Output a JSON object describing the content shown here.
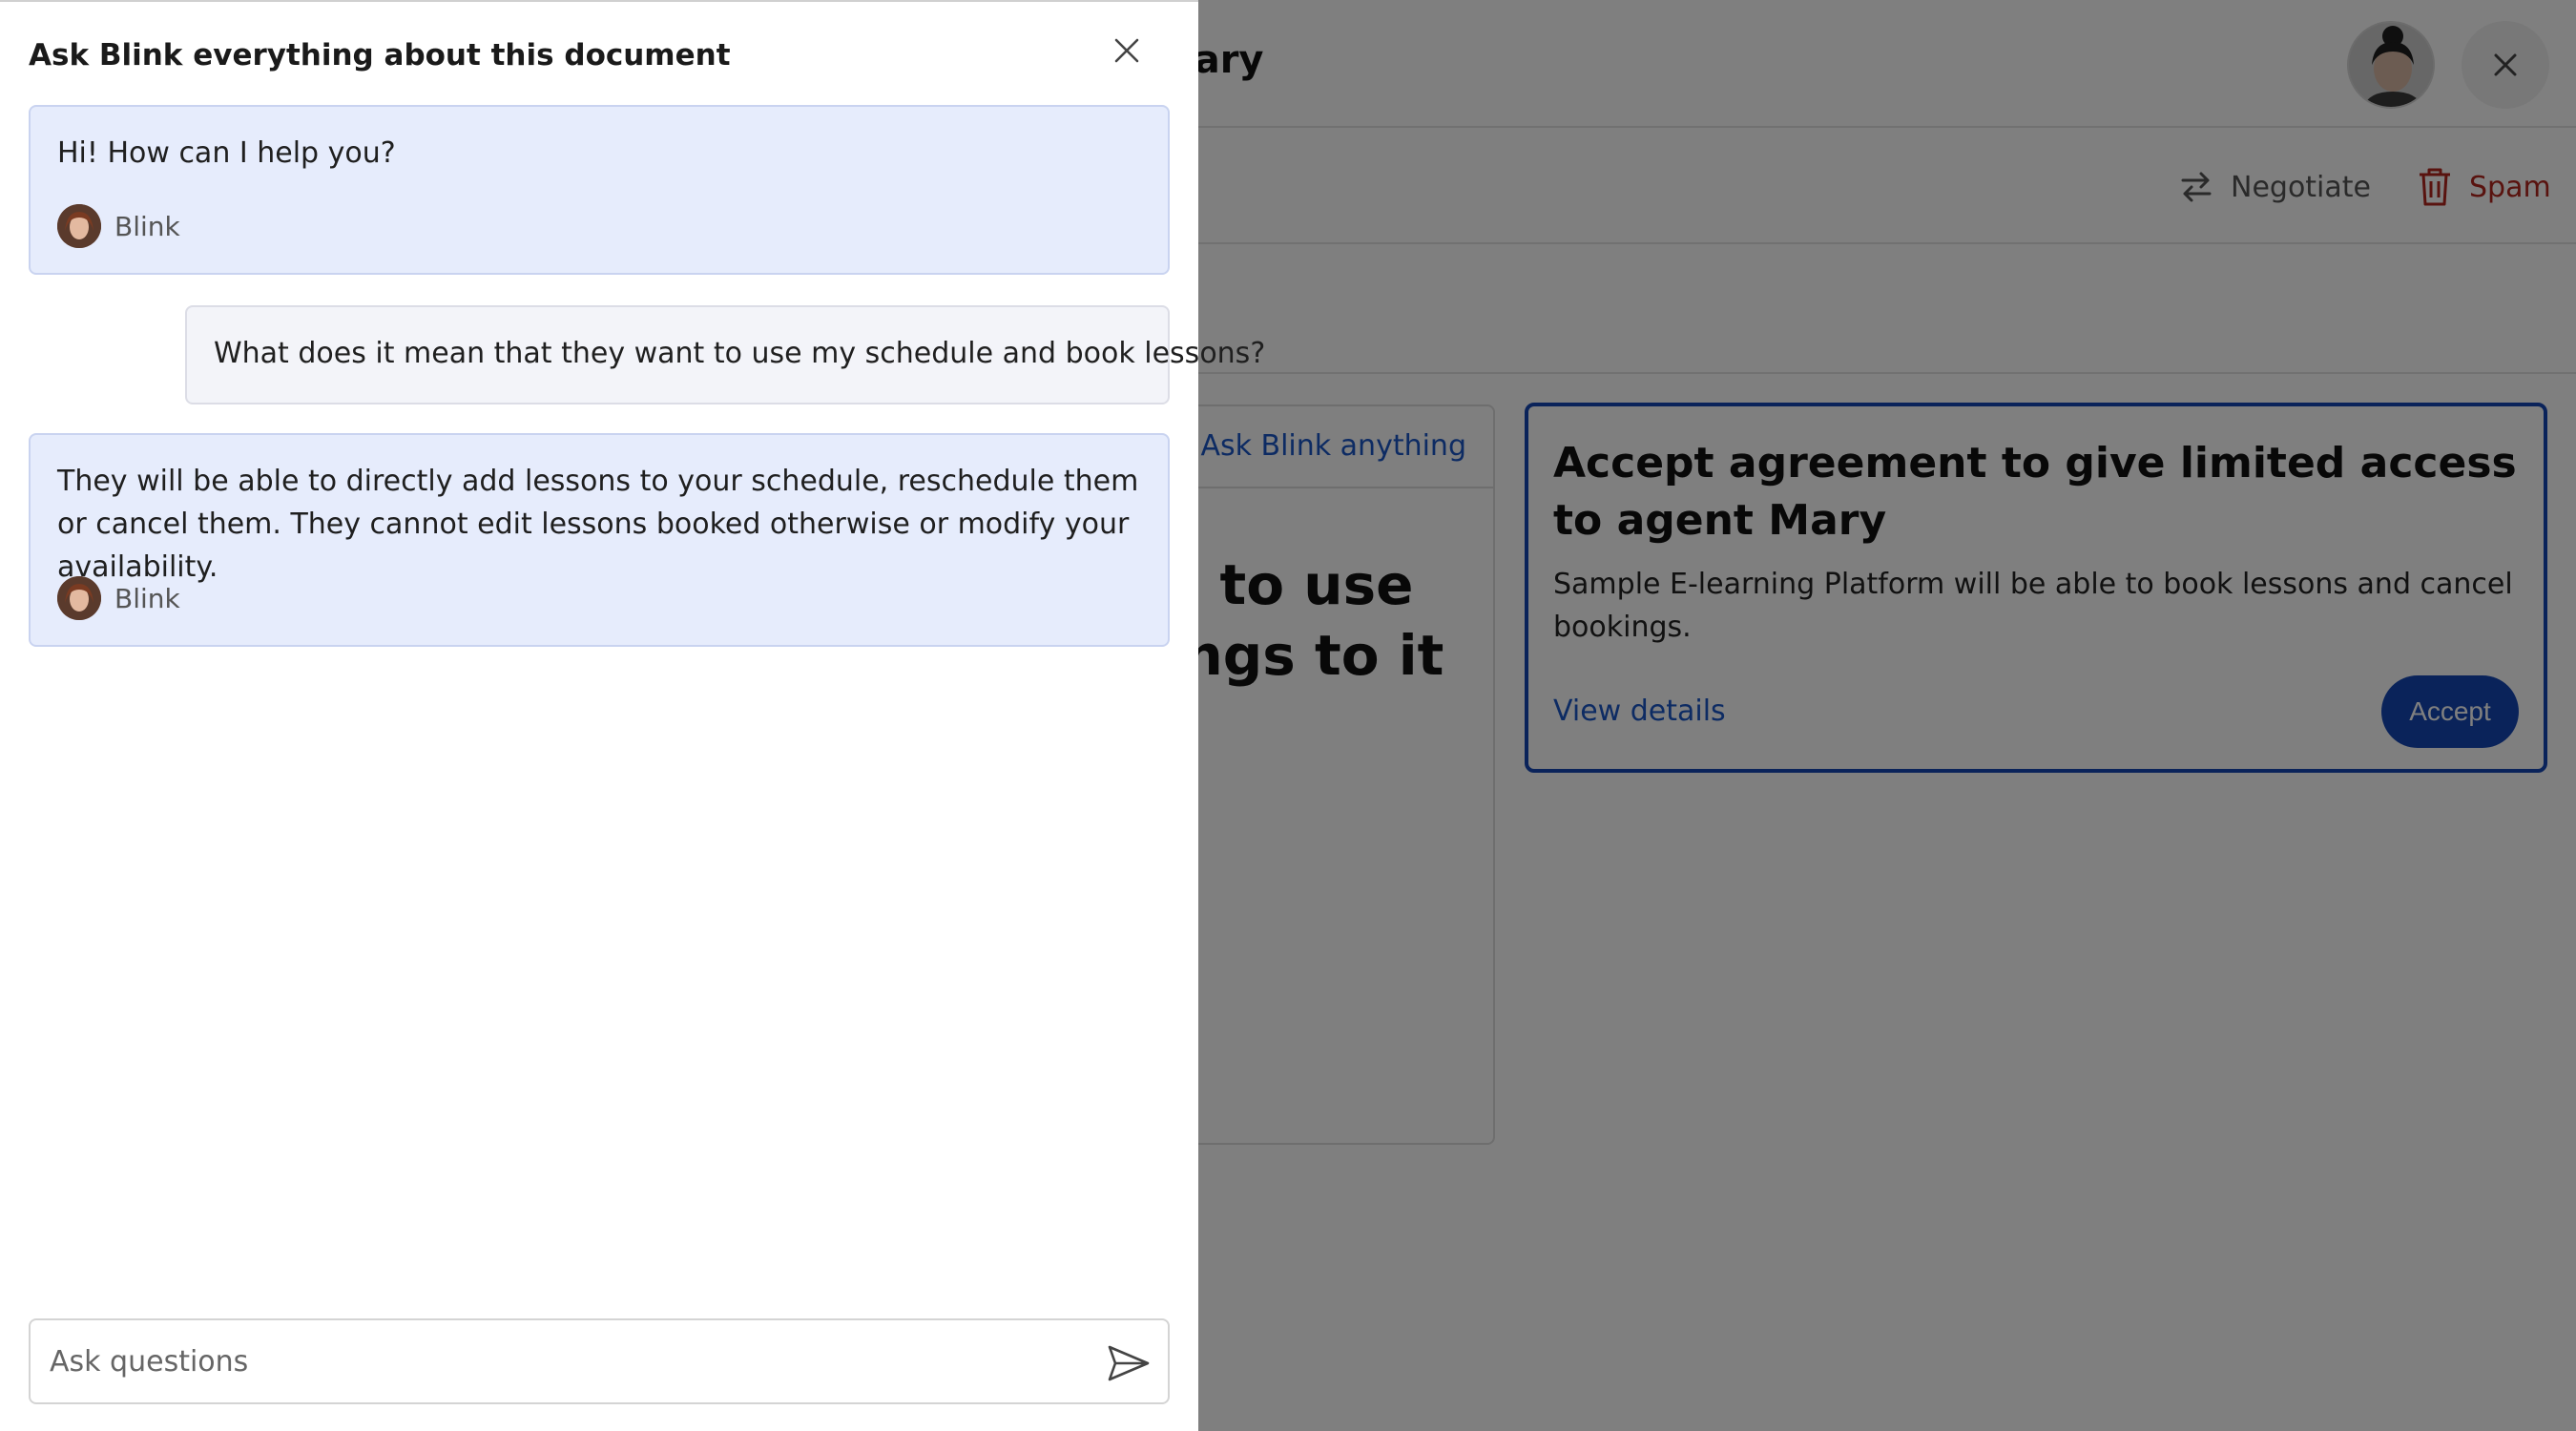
{
  "page": {
    "title_partial": "lary",
    "toolbar": {
      "negotiate_label": "Negotiate",
      "spam_label": "Spam"
    },
    "document": {
      "ask_link": "Ask Blink anything",
      "heading_line1": "ke to use",
      "heading_line2": "kings to it"
    },
    "agreement": {
      "title": "Accept agreement to give limited access to agent Mary",
      "description": "Sample E-learning Platform will be able to book lessons and cancel bookings.",
      "view_details_label": "View details",
      "accept_label": "Accept"
    }
  },
  "chat": {
    "title": "Ask Blink everything about this document",
    "messages": [
      {
        "role": "bot",
        "text": "Hi! How can I help you?",
        "author": "Blink"
      },
      {
        "role": "user",
        "text": "What does it mean that they want to use my schedule and book lessons?"
      },
      {
        "role": "bot",
        "text": "They will be able to directly add lessons to your schedule, reschedule them or cancel them. They cannot edit lessons booked otherwise or modify your availability.",
        "author": "Blink"
      }
    ],
    "input": {
      "placeholder": "Ask questions",
      "value": ""
    }
  },
  "colors": {
    "accent": "#1547b5",
    "link": "#1a56c7",
    "spam": "#b3261e",
    "bot_bubble": "#e6ecfc",
    "user_bubble": "#f3f4f9"
  },
  "icons": {
    "drawer_close": "close-icon",
    "send": "send-icon",
    "negotiate": "swap-arrows-icon",
    "spam": "trash-icon",
    "page_close": "close-icon"
  }
}
